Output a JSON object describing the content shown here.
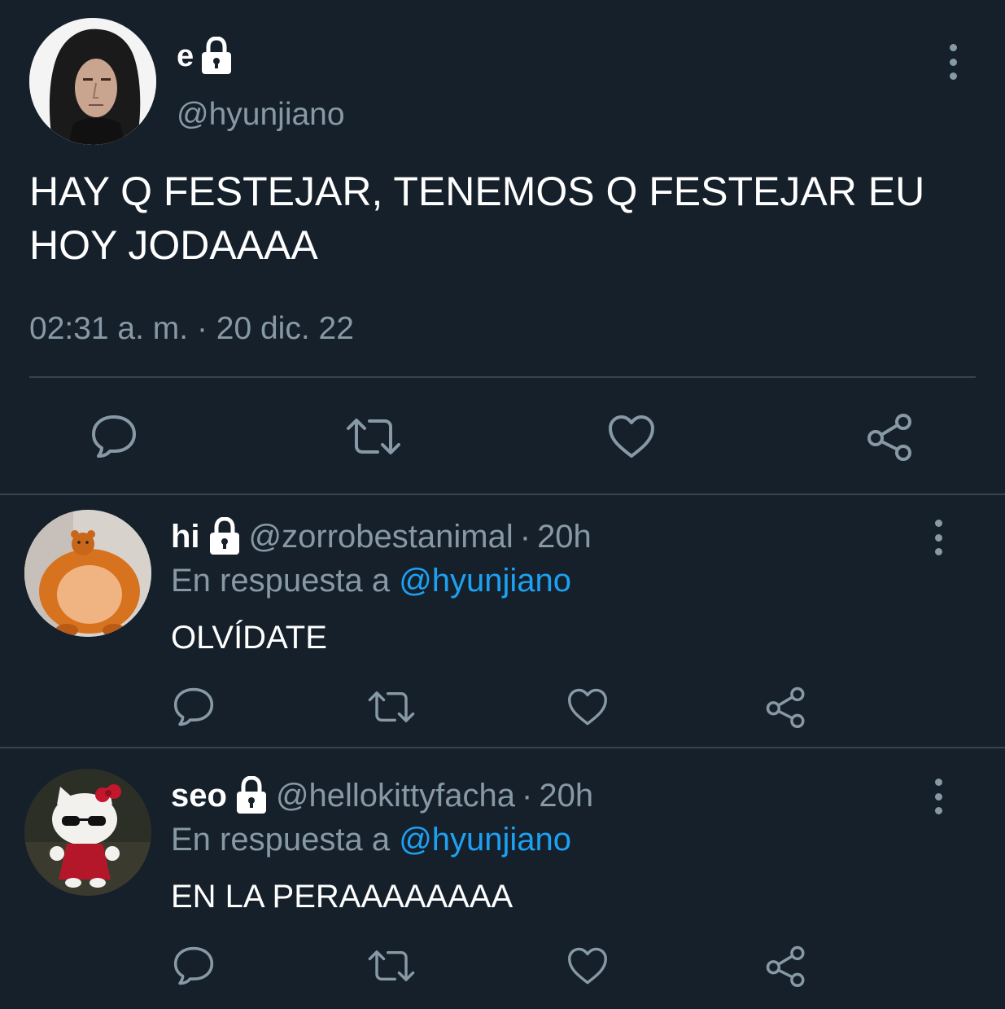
{
  "main_tweet": {
    "display_name": "e",
    "handle": "@hyunjiano",
    "text": "HAY Q FESTEJAR, TENEMOS Q FESTEJAR EU HOY JODAAAA",
    "timestamp": "02:31 a. m. · 20 dic. 22",
    "protected": true,
    "actions": [
      "reply-icon",
      "retweet-icon",
      "like-icon",
      "share-icon"
    ]
  },
  "replies": [
    {
      "display_name": "hi",
      "handle": "@zorrobestanimal",
      "separator": "·",
      "time": "20h",
      "context_prefix": "En respuesta a",
      "context_mention": "@hyunjiano",
      "text": "OLVÍDATE",
      "protected": true
    },
    {
      "display_name": "seo",
      "handle": "@hellokittyfacha",
      "separator": "·",
      "time": "20h",
      "context_prefix": "En respuesta a",
      "context_mention": "@hyunjiano",
      "text": "EN LA PERAAAAAAAA",
      "protected": true
    }
  ],
  "colors": {
    "background": "#15202b",
    "secondary_text": "#8899a6",
    "mention": "#1da1f2",
    "divider": "#38444d"
  }
}
